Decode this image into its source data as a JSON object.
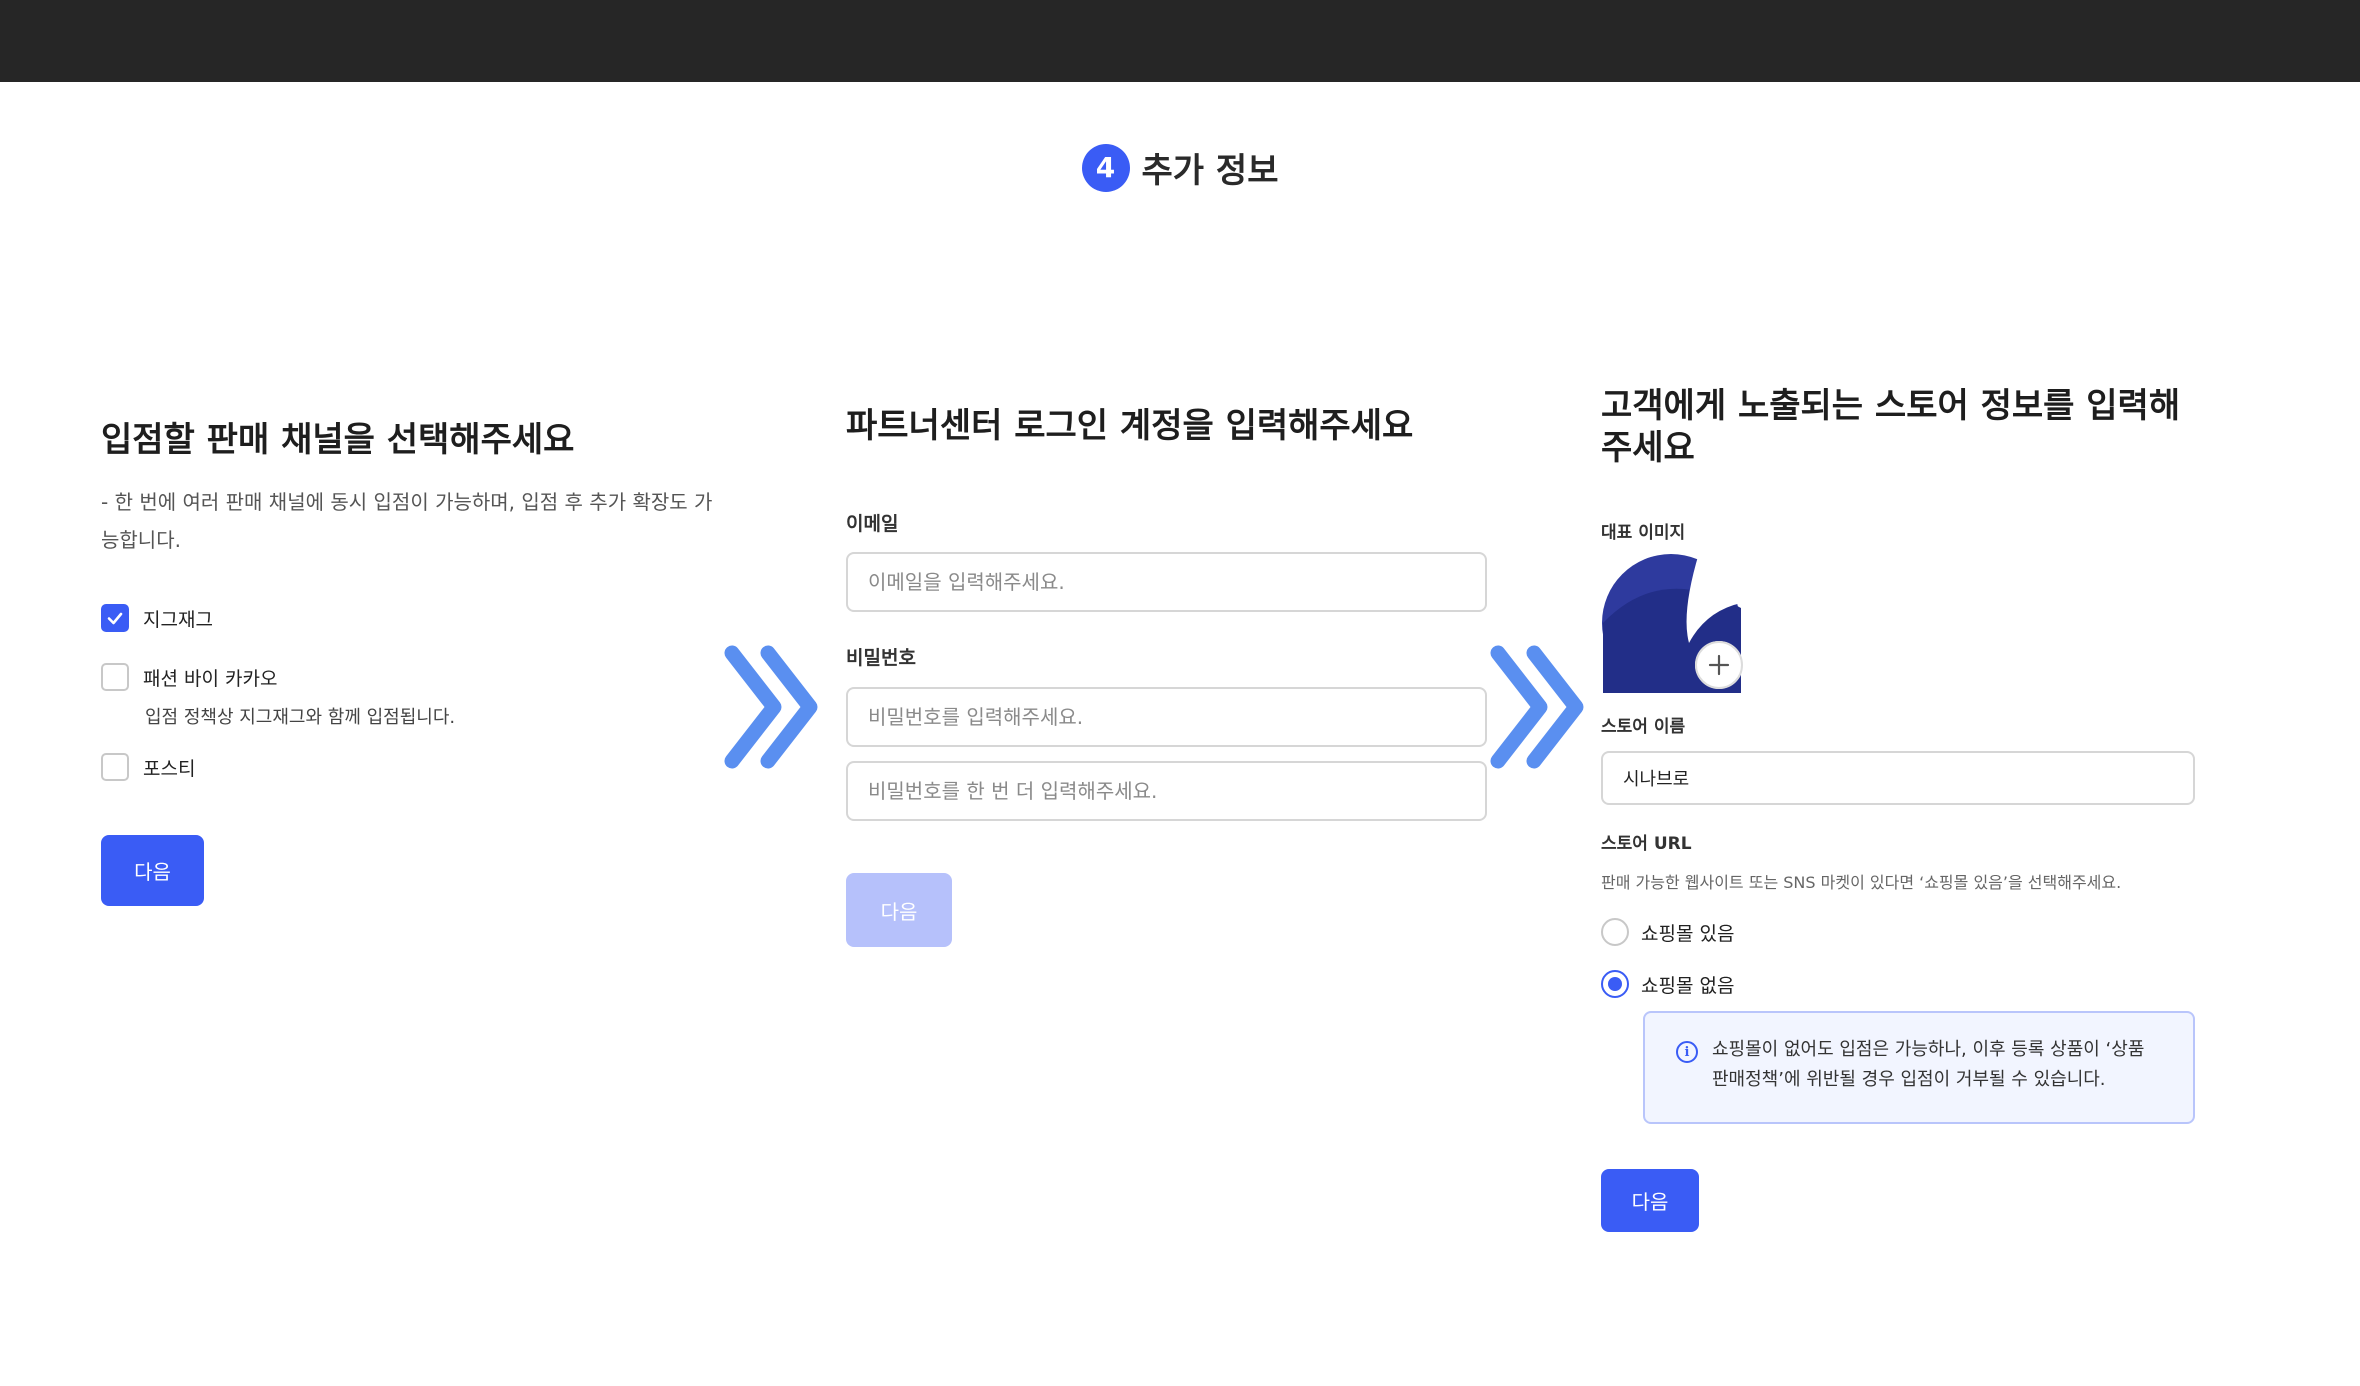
{
  "header": {
    "step_number": "4",
    "step_title": "추가 정보"
  },
  "channel_panel": {
    "title": "입점할 판매 채널을 선택해주세요",
    "description_line1": "- 한 번에 여러 판매 채널에 동시 입점이 가능하며, 입점 후 추가 확장도 가",
    "description_line2": "능합니다.",
    "options": [
      {
        "label": "지그재그",
        "checked": true
      },
      {
        "label": "패션 바이 카카오",
        "checked": false,
        "note": "입점 정책상 지그재그와 함께 입점됩니다."
      },
      {
        "label": "포스티",
        "checked": false
      }
    ],
    "next_label": "다음"
  },
  "account_panel": {
    "title": "파트너센터 로그인 계정을 입력해주세요",
    "email_label": "이메일",
    "email_placeholder": "이메일을 입력해주세요.",
    "password_label": "비밀번호",
    "password_placeholder": "비밀번호를 입력해주세요.",
    "password_confirm_placeholder": "비밀번호를 한 번 더 입력해주세요.",
    "next_label": "다음",
    "next_disabled": true
  },
  "store_panel": {
    "title_line1": "고객에게 노출되는 스토어 정보를 입력해",
    "title_line2": "주세요",
    "image_label": "대표 이미지",
    "name_label": "스토어 이름",
    "name_value": "시나브로",
    "url_label": "스토어 URL",
    "url_help": "판매 가능한 웹사이트 또는 SNS 마켓이 있다면 ‘쇼핑몰 있음’을 선택해주세요.",
    "radio_options": [
      {
        "label": "쇼핑몰 있음",
        "selected": false
      },
      {
        "label": "쇼핑몰 없음",
        "selected": true
      }
    ],
    "info_line1": "쇼핑몰이 없어도 입점은 가능하나, 이후 등록 상품이 ‘상품",
    "info_line2": "판매정책’에 위반될 경우 입점이 거부될 수 있습니다.",
    "next_label": "다음"
  },
  "colors": {
    "accent": "#3a5cf5",
    "accent_disabled": "#b6c1fb",
    "arrow": "#5a8ff0",
    "topbar": "#262626",
    "info_bg": "#f2f5ff"
  },
  "icons": [
    "check-icon",
    "double-chevron-right-icon",
    "plus-icon",
    "info-icon"
  ]
}
